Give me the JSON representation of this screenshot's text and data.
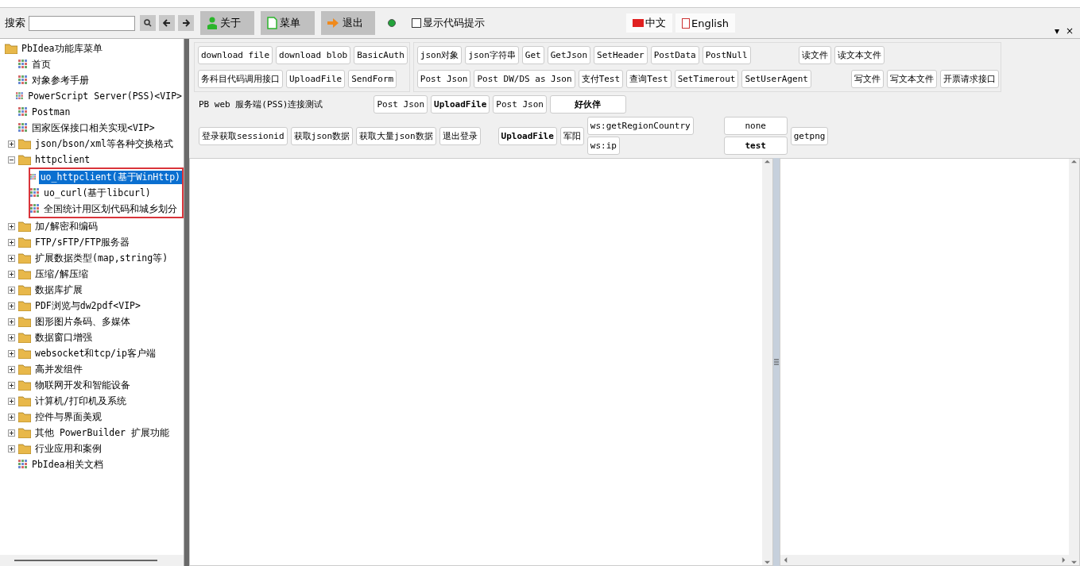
{
  "toolbar": {
    "search_label": "搜索",
    "buttons": [
      {
        "kind": "about",
        "label": "关于"
      },
      {
        "kind": "menu",
        "label": "菜单"
      },
      {
        "kind": "exit",
        "label": "退出"
      }
    ],
    "status_on": true,
    "code_hint": {
      "label": "显示代码提示",
      "checked": false
    },
    "languages": [
      {
        "kind": "cn",
        "label": "中文"
      },
      {
        "kind": "en",
        "label": "English"
      }
    ],
    "window_controls": [
      "▾",
      "×"
    ]
  },
  "tree": [
    {
      "label": "PbIdea功能库菜单",
      "kind": "folder",
      "children": [
        {
          "label": "首页",
          "kind": "page",
          "selected": false
        },
        {
          "label": "对象参考手册",
          "kind": "page",
          "selected": false
        },
        {
          "label": "PowerScript Server(PSS)<VIP>",
          "kind": "page",
          "selected": false
        },
        {
          "label": "Postman",
          "kind": "page",
          "selected": false
        },
        {
          "label": "国家医保接口相关实现<VIP>",
          "kind": "page",
          "selected": false
        },
        {
          "label": "json/bson/xml等各种交换格式",
          "kind": "folder",
          "expanded": false
        },
        {
          "label": "httpclient",
          "kind": "folder",
          "expanded": true,
          "highlight": true,
          "children": [
            {
              "label": "uo_httpclient(基于WinHttp)",
              "kind": "page",
              "selected": true
            },
            {
              "label": "uo_curl(基于libcurl)",
              "kind": "page",
              "selected": false
            },
            {
              "label": "全国统计用区划代码和城乡划分",
              "kind": "page",
              "selected": false
            }
          ]
        },
        {
          "label": "加/解密和编码",
          "kind": "folder",
          "expanded": false
        },
        {
          "label": "FTP/sFTP/FTP服务器",
          "kind": "folder",
          "expanded": false
        },
        {
          "label": "扩展数据类型(map,string等)",
          "kind": "folder",
          "expanded": false
        },
        {
          "label": "压缩/解压缩",
          "kind": "folder",
          "expanded": false
        },
        {
          "label": "数据库扩展",
          "kind": "folder",
          "expanded": false
        },
        {
          "label": "PDF浏览与dw2pdf<VIP>",
          "kind": "folder",
          "expanded": false
        },
        {
          "label": "图形图片条码、多媒体",
          "kind": "folder",
          "expanded": false
        },
        {
          "label": "数据窗口增强",
          "kind": "folder",
          "expanded": false
        },
        {
          "label": "websocket和tcp/ip客户端",
          "kind": "folder",
          "expanded": false
        },
        {
          "label": "高并发组件",
          "kind": "folder",
          "expanded": false
        },
        {
          "label": "物联网开发和智能设备",
          "kind": "folder",
          "expanded": false
        },
        {
          "label": "计算机/打印机及系统",
          "kind": "folder",
          "expanded": false
        },
        {
          "label": "控件与界面美观",
          "kind": "folder",
          "expanded": false
        },
        {
          "label": "其他 PowerBuilder 扩展功能",
          "kind": "folder",
          "expanded": false
        },
        {
          "label": "行业应用和案例",
          "kind": "folder",
          "expanded": false
        },
        {
          "label": "PbIdea相关文档",
          "kind": "page",
          "selected": false
        }
      ]
    }
  ],
  "panel_a": [
    [
      "download file",
      "download blob",
      "BasicAuth"
    ],
    [
      "务科目代码调用接口",
      "UploadFile",
      "SendForm"
    ]
  ],
  "panel_b": [
    {
      "left": [
        "json对象",
        "json字符串",
        "Get",
        "GetJson",
        "SetHeader",
        "PostData",
        "PostNull"
      ],
      "right": [
        "读文件",
        "读文本文件"
      ]
    },
    {
      "left": [
        "Post Json",
        "Post DW/DS as Json",
        "支付Test",
        "查询Test",
        "SetTimerout",
        "SetUserAgent"
      ],
      "right": [
        "写文件",
        "写文本文件",
        "开票请求接口"
      ]
    }
  ],
  "pss": {
    "title": "PB web 服务端(PSS)连接测试",
    "top": [
      {
        "label": "Post Json",
        "bold": false
      },
      {
        "label": "UploadFile",
        "bold": true
      },
      {
        "label": "Post Json",
        "bold": false
      },
      {
        "label": "好伙伴",
        "bold": true
      }
    ],
    "bottom": [
      {
        "label": "登录获取sessionid",
        "bold": false
      },
      {
        "label": "获取json数据",
        "bold": false
      },
      {
        "label": "获取大量json数据",
        "bold": false
      },
      {
        "label": "退出登录",
        "bold": false
      }
    ],
    "extra": [
      {
        "label": "UploadFile",
        "bold": true
      },
      {
        "label": "军阳",
        "bold": false
      }
    ],
    "stack1": [
      {
        "label": "ws:getRegionCountry",
        "bold": false
      },
      {
        "label": "ws:ip",
        "bold": false
      }
    ],
    "stack2": [
      {
        "label": "none",
        "bold": false
      },
      {
        "label": "test",
        "bold": true
      }
    ],
    "last": [
      {
        "label": "getpng",
        "bold": false
      }
    ]
  }
}
